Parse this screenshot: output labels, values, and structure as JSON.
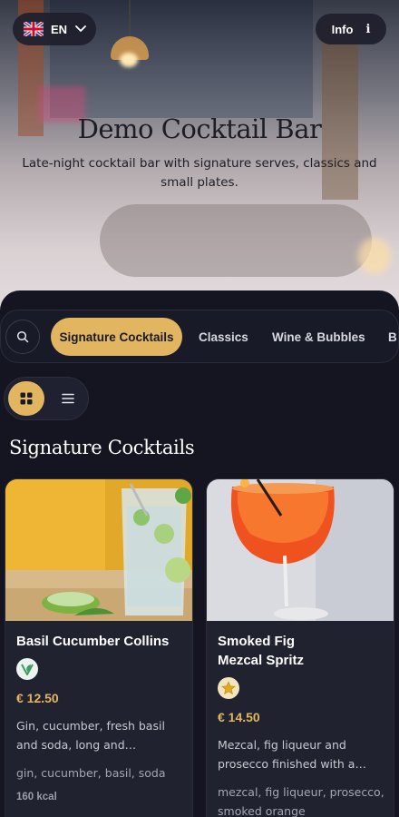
{
  "header": {
    "language": {
      "code": "EN",
      "flag": "uk-flag-icon"
    },
    "info_label": "Info",
    "title": "Demo Cocktail Bar",
    "subtitle": "Late-night cocktail bar with signature serves, classics and small plates."
  },
  "categories": {
    "tabs": [
      {
        "label": "Signature Cocktails",
        "active": true
      },
      {
        "label": "Classics",
        "active": false
      },
      {
        "label": "Wine & Bubbles",
        "active": false
      },
      {
        "label": "B",
        "active": false
      }
    ]
  },
  "view_toggle": {
    "selected": "grid",
    "options": [
      "grid",
      "list"
    ]
  },
  "section": {
    "title": "Signature Cocktails"
  },
  "items": [
    {
      "name": "Basil Cucumber Collins",
      "badge": "vegan-leaf-icon",
      "price": "€ 12.50",
      "description": "Gin, cucumber, fresh basil and soda, long and…",
      "tags": "gin, cucumber, basil, soda",
      "kcal": "160 kcal"
    },
    {
      "name_line1": "Smoked Fig",
      "name_line2": "Mezcal Spritz",
      "badge": "star-icon",
      "price": "€ 14.50",
      "description": "Mezcal, fig liqueur and prosecco finished with a…",
      "tags": "mezcal, fig liqueur, prosecco, smoked orange"
    }
  ],
  "colors": {
    "accent": "#e2b661",
    "panel": "#141520",
    "card": "#20222f"
  }
}
